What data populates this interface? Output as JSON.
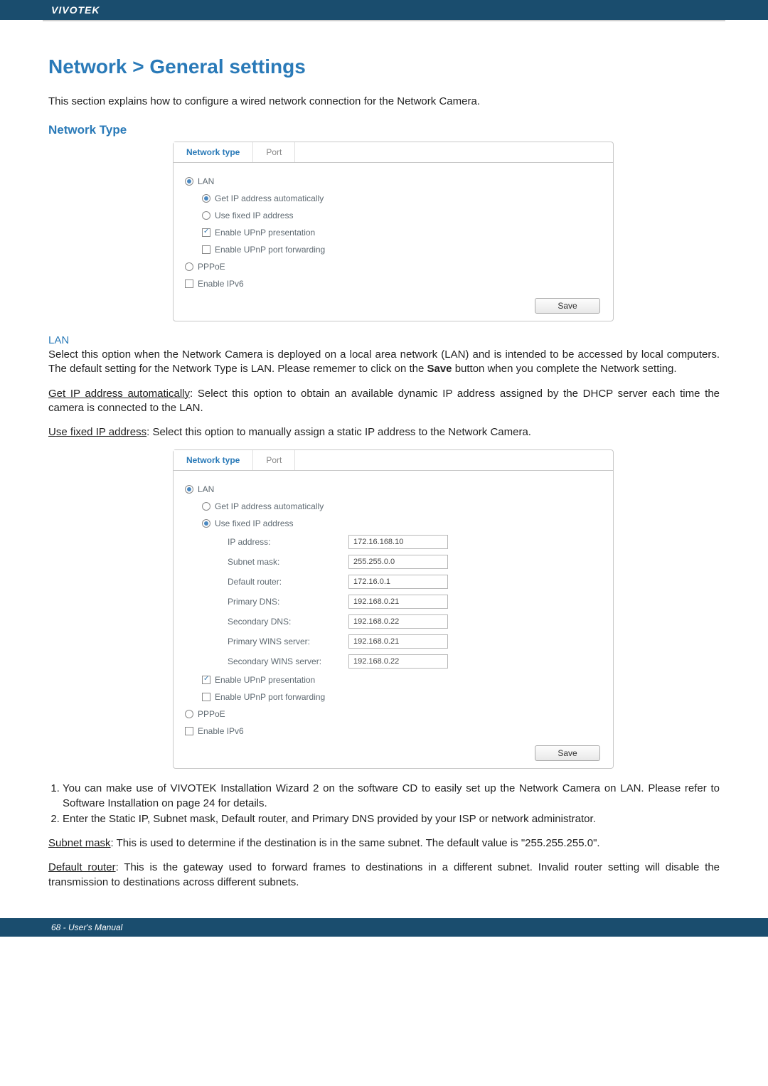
{
  "header": {
    "brand": "VIVOTEK"
  },
  "title": "Network > General settings",
  "intro": "This section explains how to configure a wired network connection for the Network Camera.",
  "network_type_heading": "Network Type",
  "tabs": {
    "network_type": "Network type",
    "port": "Port"
  },
  "panel1": {
    "lan": "LAN",
    "get_ip": "Get IP address automatically",
    "use_fixed": "Use fixed IP address",
    "upnp_pres": "Enable UPnP presentation",
    "upnp_port": "Enable UPnP port forwarding",
    "pppoe": "PPPoE",
    "ipv6": "Enable IPv6",
    "save": "Save"
  },
  "lan_heading": "LAN",
  "lan_para": "Select this option when the Network Camera is deployed on a local area network (LAN) and is intended to be accessed by local computers. The default setting for the Network Type is LAN. Please rememer to click on the ",
  "lan_para_bold": "Save",
  "lan_para_tail": " button when you complete the Network setting.",
  "get_ip_u": "Get IP address automatically",
  "get_ip_tail": ": Select this option to obtain an available dynamic IP address assigned by the DHCP server each time the camera is connected to the LAN.",
  "use_fixed_u": "Use fixed IP address",
  "use_fixed_tail": ": Select this option to manually assign a static IP address to the Network Camera.",
  "panel2": {
    "lan": "LAN",
    "get_ip": "Get IP address automatically",
    "use_fixed": "Use fixed IP address",
    "fields": {
      "ip_label": "IP address:",
      "ip_val": "172.16.168.10",
      "subnet_label": "Subnet mask:",
      "subnet_val": "255.255.0.0",
      "router_label": "Default router:",
      "router_val": "172.16.0.1",
      "pdns_label": "Primary DNS:",
      "pdns_val": "192.168.0.21",
      "sdns_label": "Secondary DNS:",
      "sdns_val": "192.168.0.22",
      "pwins_label": "Primary WINS server:",
      "pwins_val": "192.168.0.21",
      "swins_label": "Secondary WINS server:",
      "swins_val": "192.168.0.22"
    },
    "upnp_pres": "Enable UPnP presentation",
    "upnp_port": "Enable UPnP port forwarding",
    "pppoe": "PPPoE",
    "ipv6": "Enable IPv6",
    "save": "Save"
  },
  "list": {
    "item1": "You can make use of VIVOTEK Installation Wizard 2 on the software CD to easily set up the Network Camera on LAN. Please refer to Software Installation on page 24 for details.",
    "item2": "Enter the Static IP, Subnet mask, Default router, and Primary DNS provided by your ISP or network administrator."
  },
  "subnet_u": "Subnet mask",
  "subnet_tail": ": This is used to determine if the destination is in the same subnet. The default value is \"255.255.255.0\".",
  "router_u": "Default router",
  "router_tail": ": This is the gateway used to forward frames to destinations in a different subnet. Invalid router setting will disable the transmission to destinations across different subnets.",
  "footer": "68 - User's Manual"
}
